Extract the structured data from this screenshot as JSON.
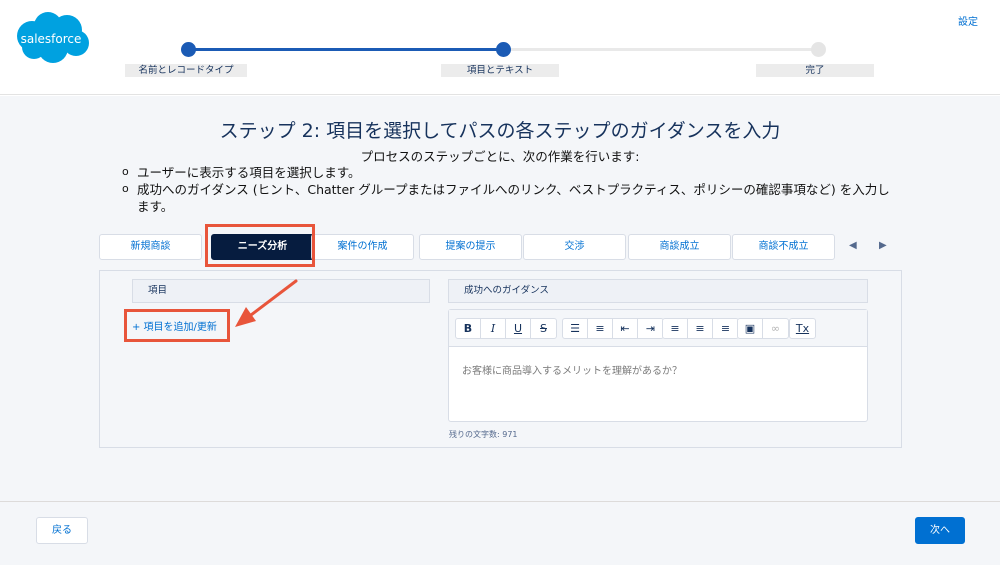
{
  "header": {
    "logo_text": "salesforce",
    "settings_label": "設定",
    "steps": [
      "名前とレコードタイプ",
      "項目とテキスト",
      "完了"
    ]
  },
  "main": {
    "title": "ステップ 2: 項目を選択してパスの各ステップのガイダンスを入力",
    "subtitle": "プロセスのステップごとに、次の作業を行います:",
    "bullets": [
      "ユーザーに表示する項目を選択します。",
      "成功へのガイダンス (ヒント、Chatter グループまたはファイルへのリンク、ベストプラクティス、ポリシーの確認事項など) を入力します。"
    ],
    "tabs": [
      "新規商談",
      "ニーズ分析",
      "案件の作成",
      "提案の提示",
      "交渉",
      "商談成立",
      "商談不成立"
    ],
    "active_tab": "ニーズ分析",
    "fields_header": "項目",
    "add_fields_link": "+ 項目を追加/更新",
    "guidance_header": "成功へのガイダンス",
    "editor_text": "お客様に商品導入するメリットを理解があるか？",
    "char_count": "残りの文字数: 971"
  },
  "footer": {
    "back_label": "戻る",
    "next_label": "次へ"
  },
  "colors": {
    "brand_blue": "#0070d2",
    "progress_blue": "#1b5bb5",
    "active_tab_bg": "#061c3f",
    "highlight_red": "#e8553b"
  }
}
